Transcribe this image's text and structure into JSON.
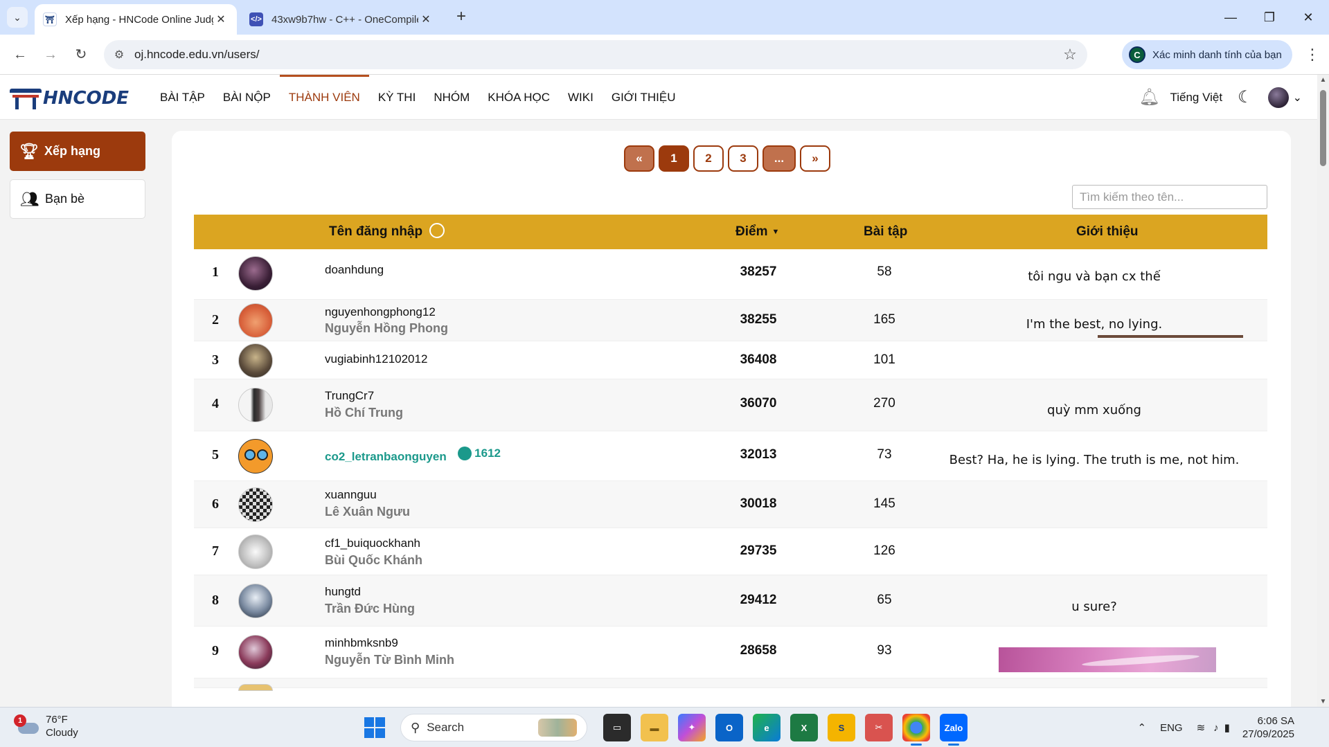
{
  "browser": {
    "tabs": [
      {
        "title": "Xếp hạng - HNCode Online Judge",
        "favicon": "hncode-favicon",
        "active": true
      },
      {
        "title": "43xw9b7hw - C++ - OneCompiler",
        "favicon": "onecompiler-favicon",
        "active": false
      }
    ],
    "url": "oj.hncode.edu.vn/users/",
    "verify_label": "Xác minh danh tính của bạn",
    "profile_initial": "C"
  },
  "site": {
    "logo_text": "HNCODE",
    "nav": [
      "BÀI TẬP",
      "BÀI NỘP",
      "THÀNH VIÊN",
      "KỲ THI",
      "NHÓM",
      "KHÓA HỌC",
      "WIKI",
      "GIỚI THIỆU"
    ],
    "active_nav": "THÀNH VIÊN",
    "language": "Tiếng Việt"
  },
  "sidebar": {
    "items": [
      {
        "label": "Xếp hạng",
        "icon": "trophy-icon",
        "active": true
      },
      {
        "label": "Bạn bè",
        "icon": "users-icon",
        "active": false
      }
    ]
  },
  "pagination": {
    "prev": "«",
    "pages": [
      "1",
      "2",
      "3"
    ],
    "current": "1",
    "ellipsis": "...",
    "next": "»"
  },
  "search": {
    "placeholder": "Tìm kiếm theo tên..."
  },
  "table": {
    "headers": {
      "username": "Tên đăng nhập",
      "points": "Điểm",
      "problems": "Bài tập",
      "about": "Giới thiệu"
    },
    "rows": [
      {
        "rank": "1",
        "username": "doanhdung",
        "fullname": "",
        "points": "38257",
        "problems": "58",
        "about": "tôi ngu và bạn cx thế"
      },
      {
        "rank": "2",
        "username": "nguyenhongphong12",
        "fullname": "Nguyễn Hồng Phong",
        "points": "38255",
        "problems": "165",
        "about": "I'm the best, no lying."
      },
      {
        "rank": "3",
        "username": "vugiabinh12102012",
        "fullname": "",
        "points": "36408",
        "problems": "101",
        "about": ""
      },
      {
        "rank": "4",
        "username": "TrungCr7",
        "fullname": "Hồ Chí Trung",
        "points": "36070",
        "problems": "270",
        "about": "quỳ mm xuống"
      },
      {
        "rank": "5",
        "username": "co2_letranbaonguyen",
        "fullname": "",
        "rating": "1612",
        "points": "32013",
        "problems": "73",
        "about": "Best? Ha, he is lying. The truth is me, not him."
      },
      {
        "rank": "6",
        "username": "xuannguu",
        "fullname": "Lê Xuân Ngưu",
        "points": "30018",
        "problems": "145",
        "about": ""
      },
      {
        "rank": "7",
        "username": "cf1_buiquockhanh",
        "fullname": "Bùi Quốc Khánh",
        "points": "29735",
        "problems": "126",
        "about": ""
      },
      {
        "rank": "8",
        "username": "hungtd",
        "fullname": "Trần Đức Hùng",
        "points": "29412",
        "problems": "65",
        "about": "u sure?"
      },
      {
        "rank": "9",
        "username": "minhbmksnb9",
        "fullname": "Nguyễn Từ Bình Minh",
        "points": "28658",
        "problems": "93",
        "about": ""
      }
    ]
  },
  "taskbar": {
    "weather_temp": "76°F",
    "weather_desc": "Cloudy",
    "weather_alert": "1",
    "search_label": "Search",
    "language": "ENG",
    "time": "6:06 SA",
    "date": "27/09/2025"
  }
}
